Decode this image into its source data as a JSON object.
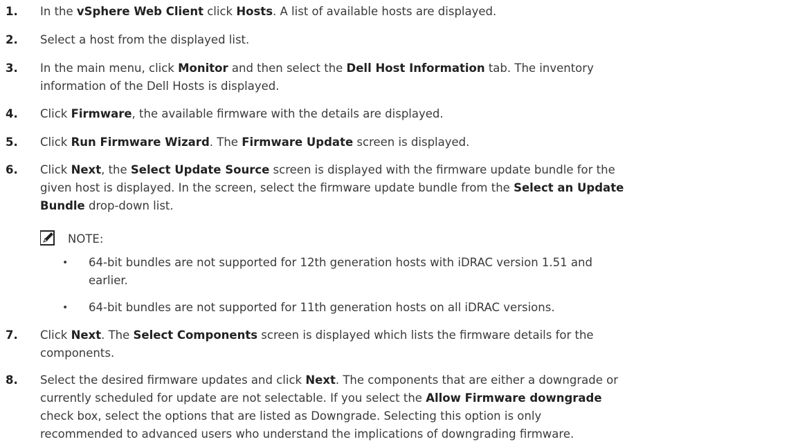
{
  "steps": [
    {
      "num": "1.",
      "lines": [
        [
          {
            "t": "In the "
          },
          {
            "t": "vSphere Web Client",
            "b": true
          },
          {
            "t": " click "
          },
          {
            "t": "Hosts",
            "b": true
          },
          {
            "t": ". A list of available hosts are displayed."
          }
        ]
      ]
    },
    {
      "num": "2.",
      "lines": [
        [
          {
            "t": "Select a host from the displayed list."
          }
        ]
      ]
    },
    {
      "num": "3.",
      "lines": [
        [
          {
            "t": "In the main menu, click "
          },
          {
            "t": "Monitor",
            "b": true
          },
          {
            "t": " and then select the "
          },
          {
            "t": "Dell Host Information",
            "b": true
          },
          {
            "t": " tab. The inventory"
          }
        ],
        [
          {
            "t": "information of the Dell Hosts is displayed."
          }
        ]
      ]
    },
    {
      "num": "4.",
      "lines": [
        [
          {
            "t": "Click "
          },
          {
            "t": "Firmware",
            "b": true
          },
          {
            "t": ", the available firmware with the details are displayed."
          }
        ]
      ]
    },
    {
      "num": "5.",
      "lines": [
        [
          {
            "t": "Click "
          },
          {
            "t": "Run Firmware Wizard",
            "b": true
          },
          {
            "t": ". The "
          },
          {
            "t": "Firmware Update",
            "b": true
          },
          {
            "t": " screen is displayed."
          }
        ]
      ]
    },
    {
      "num": "6.",
      "lines": [
        [
          {
            "t": "Click "
          },
          {
            "t": "Next",
            "b": true
          },
          {
            "t": ", the "
          },
          {
            "t": "Select Update Source",
            "b": true
          },
          {
            "t": " screen is displayed with the firmware update bundle for the"
          }
        ],
        [
          {
            "t": "given host is displayed. In the screen, select the firmware update bundle from the "
          },
          {
            "t": "Select an Update",
            "b": true
          }
        ],
        [
          {
            "t": "Bundle",
            "b": true
          },
          {
            "t": " drop-down list."
          }
        ]
      ]
    },
    {
      "num": "7.",
      "lines": [
        [
          {
            "t": "Click "
          },
          {
            "t": "Next",
            "b": true
          },
          {
            "t": ". The "
          },
          {
            "t": "Select Components",
            "b": true
          },
          {
            "t": " screen is displayed which lists the firmware details for the"
          }
        ],
        [
          {
            "t": "components."
          }
        ]
      ]
    },
    {
      "num": "8.",
      "lines": [
        [
          {
            "t": "Select the desired firmware updates and click "
          },
          {
            "t": "Next",
            "b": true
          },
          {
            "t": ". The components that are either a downgrade or"
          }
        ],
        [
          {
            "t": "currently scheduled for update are not selectable. If you select the "
          },
          {
            "t": "Allow Firmware downgrade",
            "b": true
          }
        ],
        [
          {
            "t": "check box, select the options that are listed as Downgrade. Selecting this option is only"
          }
        ],
        [
          {
            "t": "recommended to advanced users who understand the implications of downgrading firmware."
          }
        ]
      ]
    }
  ],
  "note": {
    "icon": "pencil-note-icon",
    "label": "NOTE:",
    "bullets": [
      [
        "64-bit bundles are not supported for 12th generation hosts with iDRAC version 1.51 and",
        "earlier."
      ],
      [
        "64-bit bundles are not supported for 11th generation hosts on all iDRAC versions."
      ]
    ]
  }
}
